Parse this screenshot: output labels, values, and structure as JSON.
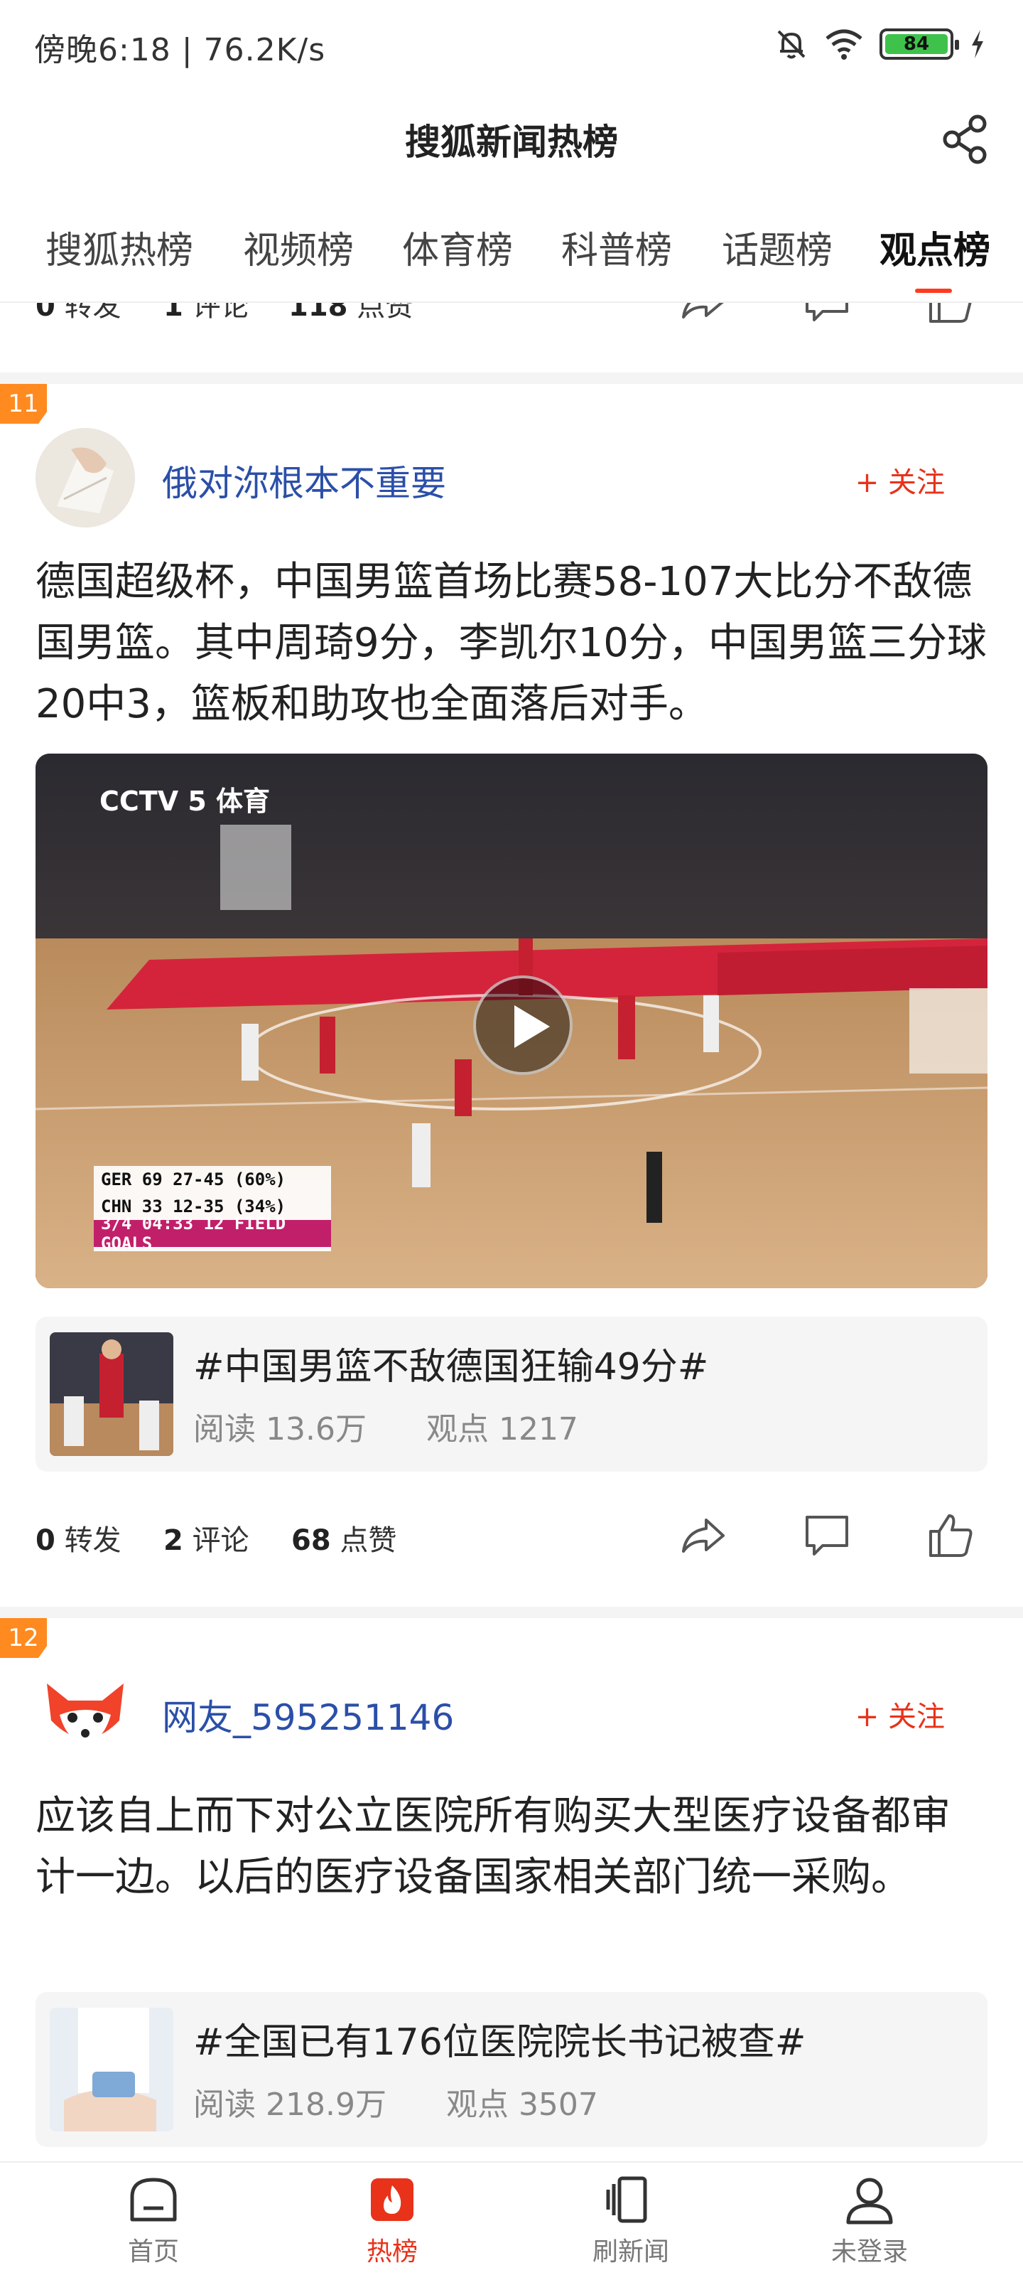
{
  "status_bar": {
    "text": "傍晚6:18 | 76.2K/s",
    "battery": "84",
    "battery_color": "#3fc24b"
  },
  "header": {
    "title": "搜狐新闻热榜"
  },
  "tabs": [
    {
      "label": "搜狐热榜"
    },
    {
      "label": "视频榜"
    },
    {
      "label": "体育榜"
    },
    {
      "label": "科普榜"
    },
    {
      "label": "话题榜"
    },
    {
      "label": "观点榜",
      "active": true
    }
  ],
  "accent_color": "#e8321a",
  "prev_item": {
    "forwards": "0",
    "forwards_label": "转发",
    "comments": "1",
    "comments_label": "评论",
    "likes": "118",
    "likes_label": "点赞"
  },
  "posts": [
    {
      "rank": "11",
      "user": "俄对沵根本不重要",
      "follow": "+ 关注",
      "text": "德国超级杯，中国男篮首场比赛58-107大比分不敌德国男篮。其中周琦9分，李凯尔10分，中国男篮三分球20中3，篮板和助攻也全面落后对手。",
      "video": {
        "channel": "CCTV 5 体育",
        "scoreboard": {
          "row1": "GER 69 27-45 (60%)",
          "row2": "CHN 33 12-35 (34%)",
          "row3": "3/4 04:33 12 FIELD GOALS"
        }
      },
      "topic": {
        "title": "#中国男篮不敌德国狂输49分#",
        "reads": "阅读 13.6万",
        "views": "观点 1217"
      },
      "forwards": "0",
      "forwards_label": "转发",
      "comments": "2",
      "comments_label": "评论",
      "likes": "68",
      "likes_label": "点赞"
    },
    {
      "rank": "12",
      "user": "网友_595251146",
      "follow": "+ 关注",
      "text": "应该自上而下对公立医院所有购买大型医疗设备都审计一边。以后的医疗设备国家相关部门统一采购。",
      "topic": {
        "title": "#全国已有176位医院院长书记被查#",
        "reads": "阅读 218.9万",
        "views": "观点 3507"
      }
    }
  ],
  "bottom_nav": [
    {
      "label": "首页",
      "icon": "home-icon"
    },
    {
      "label": "热榜",
      "icon": "flame-icon",
      "active": true
    },
    {
      "label": "刷新闻",
      "icon": "cards-icon"
    },
    {
      "label": "未登录",
      "icon": "user-icon"
    }
  ]
}
